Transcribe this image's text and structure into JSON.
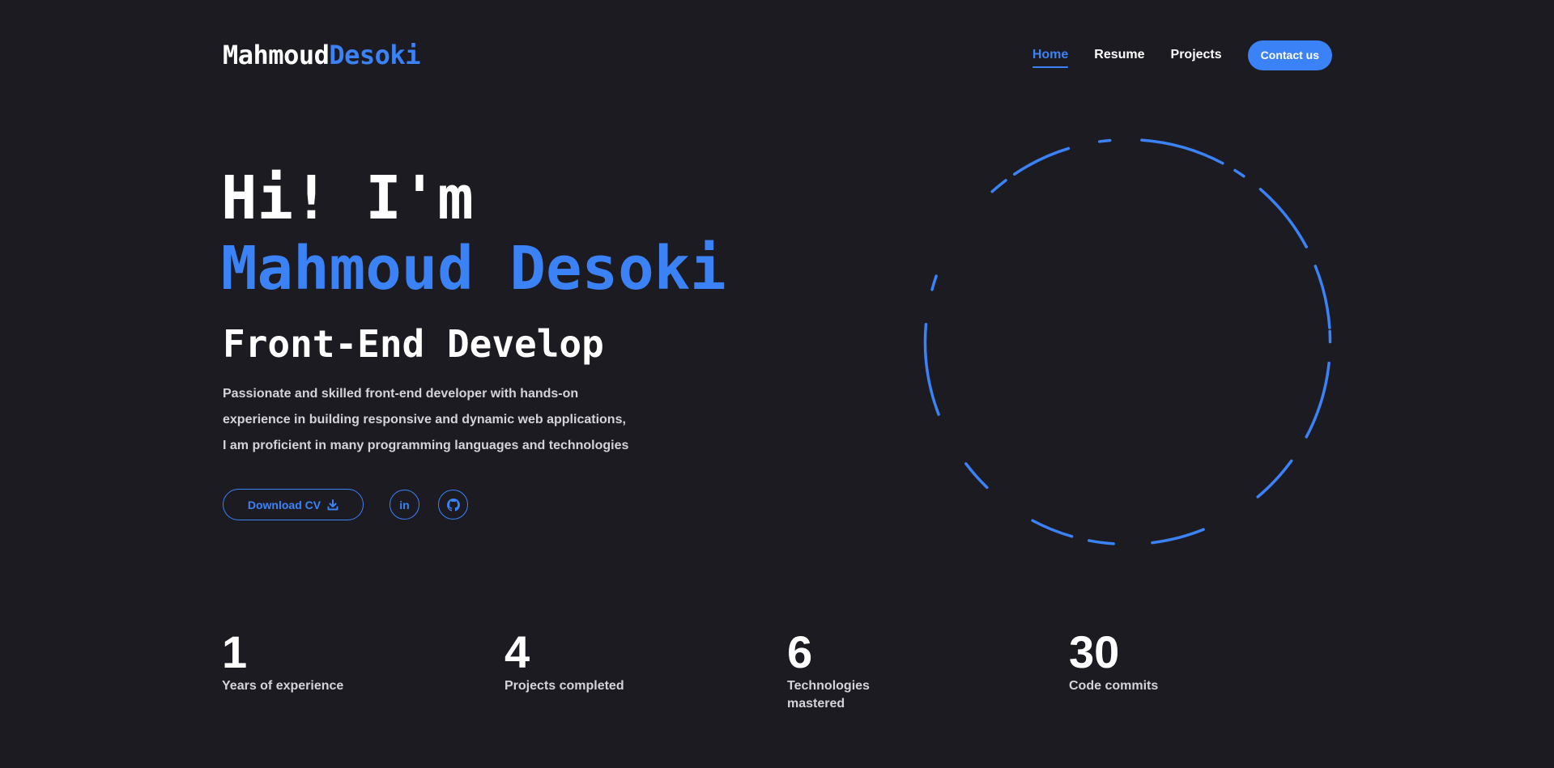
{
  "logo": {
    "first": "Mahmoud",
    "last": "Desoki"
  },
  "nav": {
    "items": [
      {
        "label": "Home",
        "active": true
      },
      {
        "label": "Resume",
        "active": false
      },
      {
        "label": "Projects",
        "active": false
      }
    ],
    "contact_label": "Contact us"
  },
  "hero": {
    "greeting": "Hi! I'm",
    "name": "Mahmoud Desoki",
    "role": "Front-End Develop",
    "description": [
      "Passionate and skilled front-end developer with hands-on",
      "experience in building responsive and dynamic web applications,",
      "I am proficient in many programming languages and technologies"
    ],
    "cv_label": "Download CV",
    "socials": [
      {
        "label": "in",
        "icon": "linkedin-icon"
      },
      {
        "icon": "github-icon"
      }
    ]
  },
  "stats": [
    {
      "value": "1",
      "label": "Years of experience"
    },
    {
      "value": "4",
      "label": "Projects completed"
    },
    {
      "value": "6",
      "label": "Technologies mastered"
    },
    {
      "value": "30",
      "label": "Code commits"
    }
  ],
  "colors": {
    "background": "#1c1b22",
    "accent": "#3b82f6",
    "text": "#ffffff",
    "muted": "#d4d4d8"
  }
}
